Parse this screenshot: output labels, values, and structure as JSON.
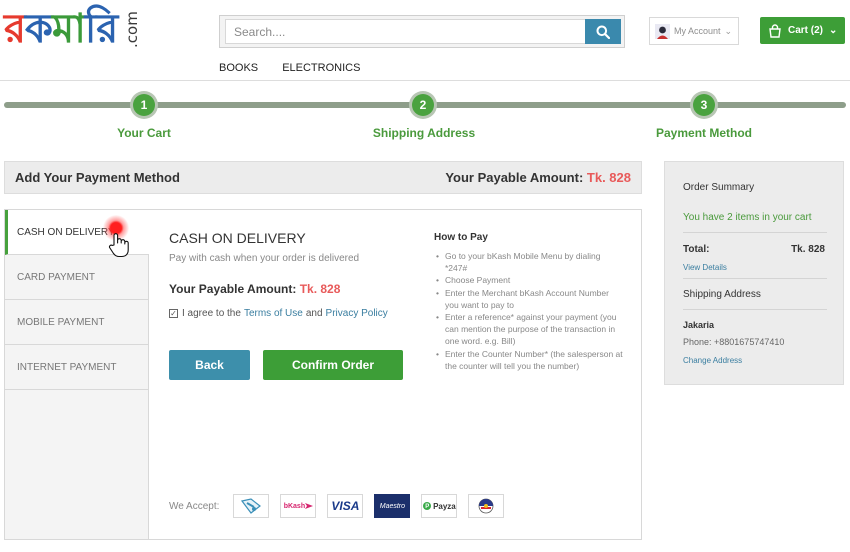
{
  "header": {
    "logo": {
      "bn_text": "রকমারি",
      "suffix": ".com"
    },
    "search": {
      "placeholder": "Search...."
    },
    "nav": [
      "BOOKS",
      "ELECTRONICS"
    ],
    "account_label": "My Account",
    "cart_label": "Cart (2)"
  },
  "steps": [
    {
      "num": "1",
      "label": "Your Cart"
    },
    {
      "num": "2",
      "label": "Shipping Address"
    },
    {
      "num": "3",
      "label": "Payment Method"
    }
  ],
  "payment": {
    "title": "Add Your Payment Method",
    "payable_label": "Your Payable Amount:",
    "payable_value": "Tk. 828",
    "tabs": [
      "CASH ON DELIVERY",
      "CARD PAYMENT",
      "MOBILE PAYMENT",
      "INTERNET PAYMENT"
    ],
    "method_title": "CASH ON DELIVERY",
    "method_sub": "Pay with cash when your order is delivered",
    "agree_prefix": "I agree to the",
    "terms_link": "Terms of Use",
    "agree_and": "and",
    "privacy_link": "Privacy Policy",
    "back_label": "Back",
    "confirm_label": "Confirm Order",
    "how_title": "How to Pay",
    "how_steps": [
      "Go to your bKash Mobile Menu by dialing *247#",
      "Choose Payment",
      "Enter the Merchant bKash Account Number you want to pay to",
      "Enter a reference* against your payment (you can mention the purpose of the transaction in one word. e.g. Bill)",
      "Enter the Counter Number* (the salesperson at the counter will tell you the number)"
    ],
    "accept_label": "We Accept:",
    "accepted": [
      "bKash",
      "VISA",
      "Maestro",
      "Payza"
    ]
  },
  "summary": {
    "title": "Order Summary",
    "items_text": "You have 2 items in your cart",
    "total_label": "Total:",
    "total_value": "Tk. 828",
    "view_details": "View Details",
    "ship_title": "Shipping Address",
    "name": "Jakaria",
    "phone": "Phone: +8801675747410",
    "change_address": "Change Address"
  },
  "colors": {
    "accent_green": "#3d9e37",
    "accent_blue": "#3d8fab",
    "amount_red": "#e85a5a"
  }
}
